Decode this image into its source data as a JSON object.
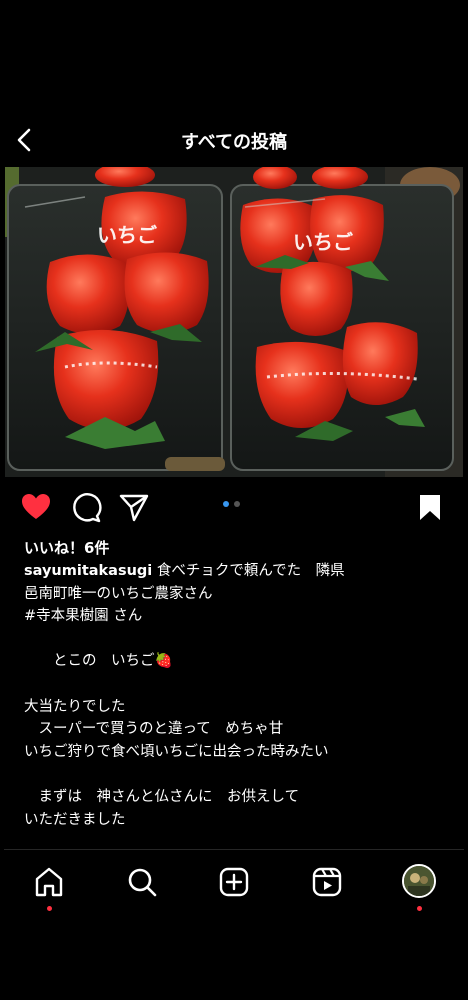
{
  "header": {
    "title": "すべての投稿"
  },
  "post": {
    "likes_label": "いいね！6件",
    "username": "sayumitakasugi",
    "caption": " 食べチョクで頼んでた　隣県\n邑南町唯一のいちご農家さん\n#寺本果樹園 さん\n\n　　とこの　いちご🍓\n\n大当たりでした\n　スーパーで買うのと違って　めちゃ甘\nいちご狩りで食べ頃いちごに出会った時みたい\n\n　まずは　神さんと仏さんに　お供えして\nいただきました",
    "image_label_text": "いちご",
    "carousel_pages": 2,
    "carousel_active": 1,
    "liked": true,
    "saved": true
  },
  "colors": {
    "like_red": "#ff3040",
    "accent_blue": "#3897f0",
    "background": "#000000"
  },
  "tabbar": {
    "items": [
      "home",
      "search",
      "create",
      "reels",
      "profile"
    ],
    "active": "home"
  },
  "icons": [
    "back-chevron-icon",
    "heart-icon",
    "comment-icon",
    "share-icon",
    "bookmark-icon",
    "home-icon",
    "search-icon",
    "create-icon",
    "reels-icon"
  ]
}
